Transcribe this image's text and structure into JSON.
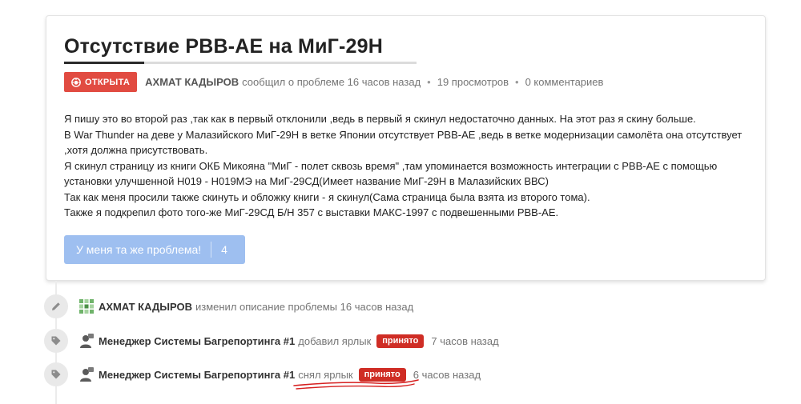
{
  "issue": {
    "title": "Отсутствие РВВ-АЕ на МиГ-29Н",
    "status": "ОТКРЫТА",
    "author": "АХМАТ КАДЫРОВ",
    "reported_text": "сообщил о проблеме 16 часов назад",
    "views": "19 просмотров",
    "comments": "0 комментариев",
    "body": [
      "Я пишу это во второй раз ,так как в первый отклонили ,ведь в первый я скинул недостаточно данных. На этот раз я скину больше.",
      "В War Thunder на деве у Малазийского МиГ-29Н в ветке Японии отсутствует РВВ-АЕ ,ведь в ветке модернизации самолёта она отсутствует ,хотя должна присутствовать.",
      "Я скинул страницу из книги ОКБ Микояна \"МиГ - полет сквозь время\" ,там упоминается возможность интеграции с РВВ-АЕ с помощью установки улучшенной Н019 - Н019МЭ на МиГ-29СД(Имеет название МиГ-29Н в Малазийских ВВС)",
      "Так как меня просили также скинуть и обложку книги - я скинул(Сама страница была взята из второго тома).",
      "Также я подкрепил фото того-же МиГ-29СД Б/Н 357 с выставки МАКС-1997 с подвешенными РВВ-АЕ."
    ],
    "metoo_label": "У меня та же проблема!",
    "metoo_count": "4"
  },
  "timeline": [
    {
      "icon": "pencil-icon",
      "name": "АХМАТ КАДЫРОВ",
      "action": "изменил описание проблемы",
      "label": "",
      "time": "16 часов назад"
    },
    {
      "icon": "tag-icon",
      "name": "Менеджер Системы Багрепортинга #1",
      "action": "добавил ярлык",
      "label": "принято",
      "time": "7 часов назад"
    },
    {
      "icon": "tag-icon",
      "name": "Менеджер Системы Багрепортинга #1",
      "action": "снял ярлык",
      "label": "принято",
      "time": "6 часов назад"
    }
  ],
  "colors": {
    "status_open": "#e14b41",
    "label_accepted": "#cf2d25",
    "metoo_button": "#9ebff0",
    "annotation_scribble": "#d62020"
  }
}
